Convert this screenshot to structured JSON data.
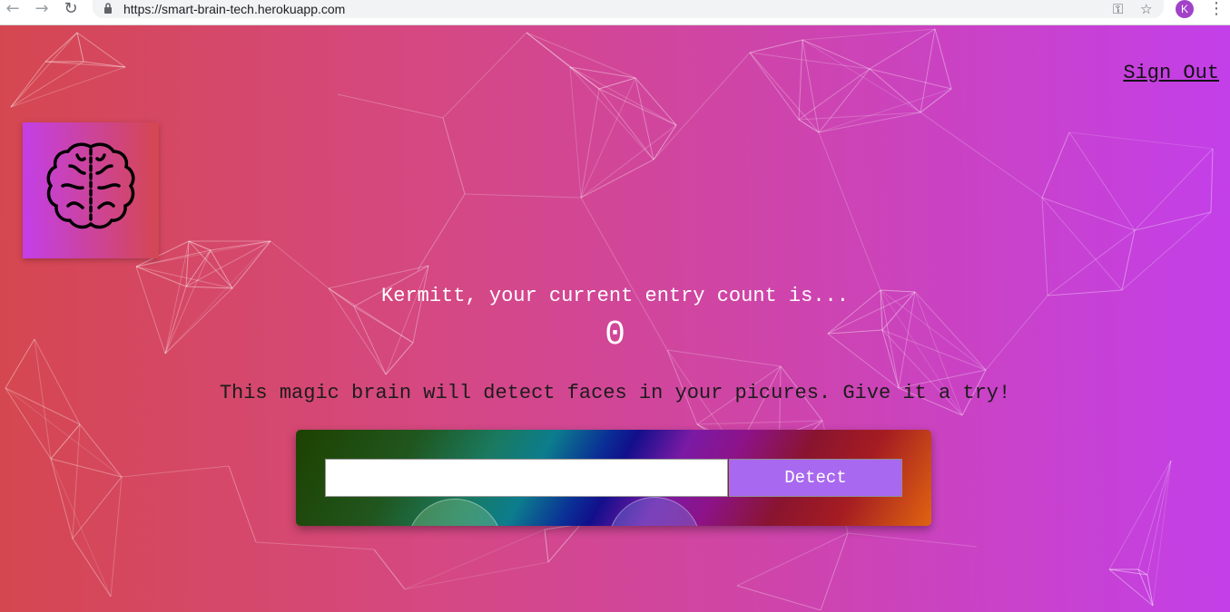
{
  "browser": {
    "url": "https://smart-brain-tech.herokuapp.com",
    "profile_initial": "K"
  },
  "nav": {
    "sign_out_label": "Sign Out"
  },
  "logo": {
    "icon": "brain-icon"
  },
  "greeting": {
    "text": "Kermitt, your current entry count is...",
    "count": "0"
  },
  "tagline": "This magic brain will detect faces in your picures. Give it a try!",
  "image_link_form": {
    "input_value": "",
    "detect_label": "Detect"
  },
  "colors": {
    "background_left": "#d5474f",
    "background_right": "#c33fe9",
    "detect_button": "#a868ef",
    "avatar": "#a142c9"
  }
}
